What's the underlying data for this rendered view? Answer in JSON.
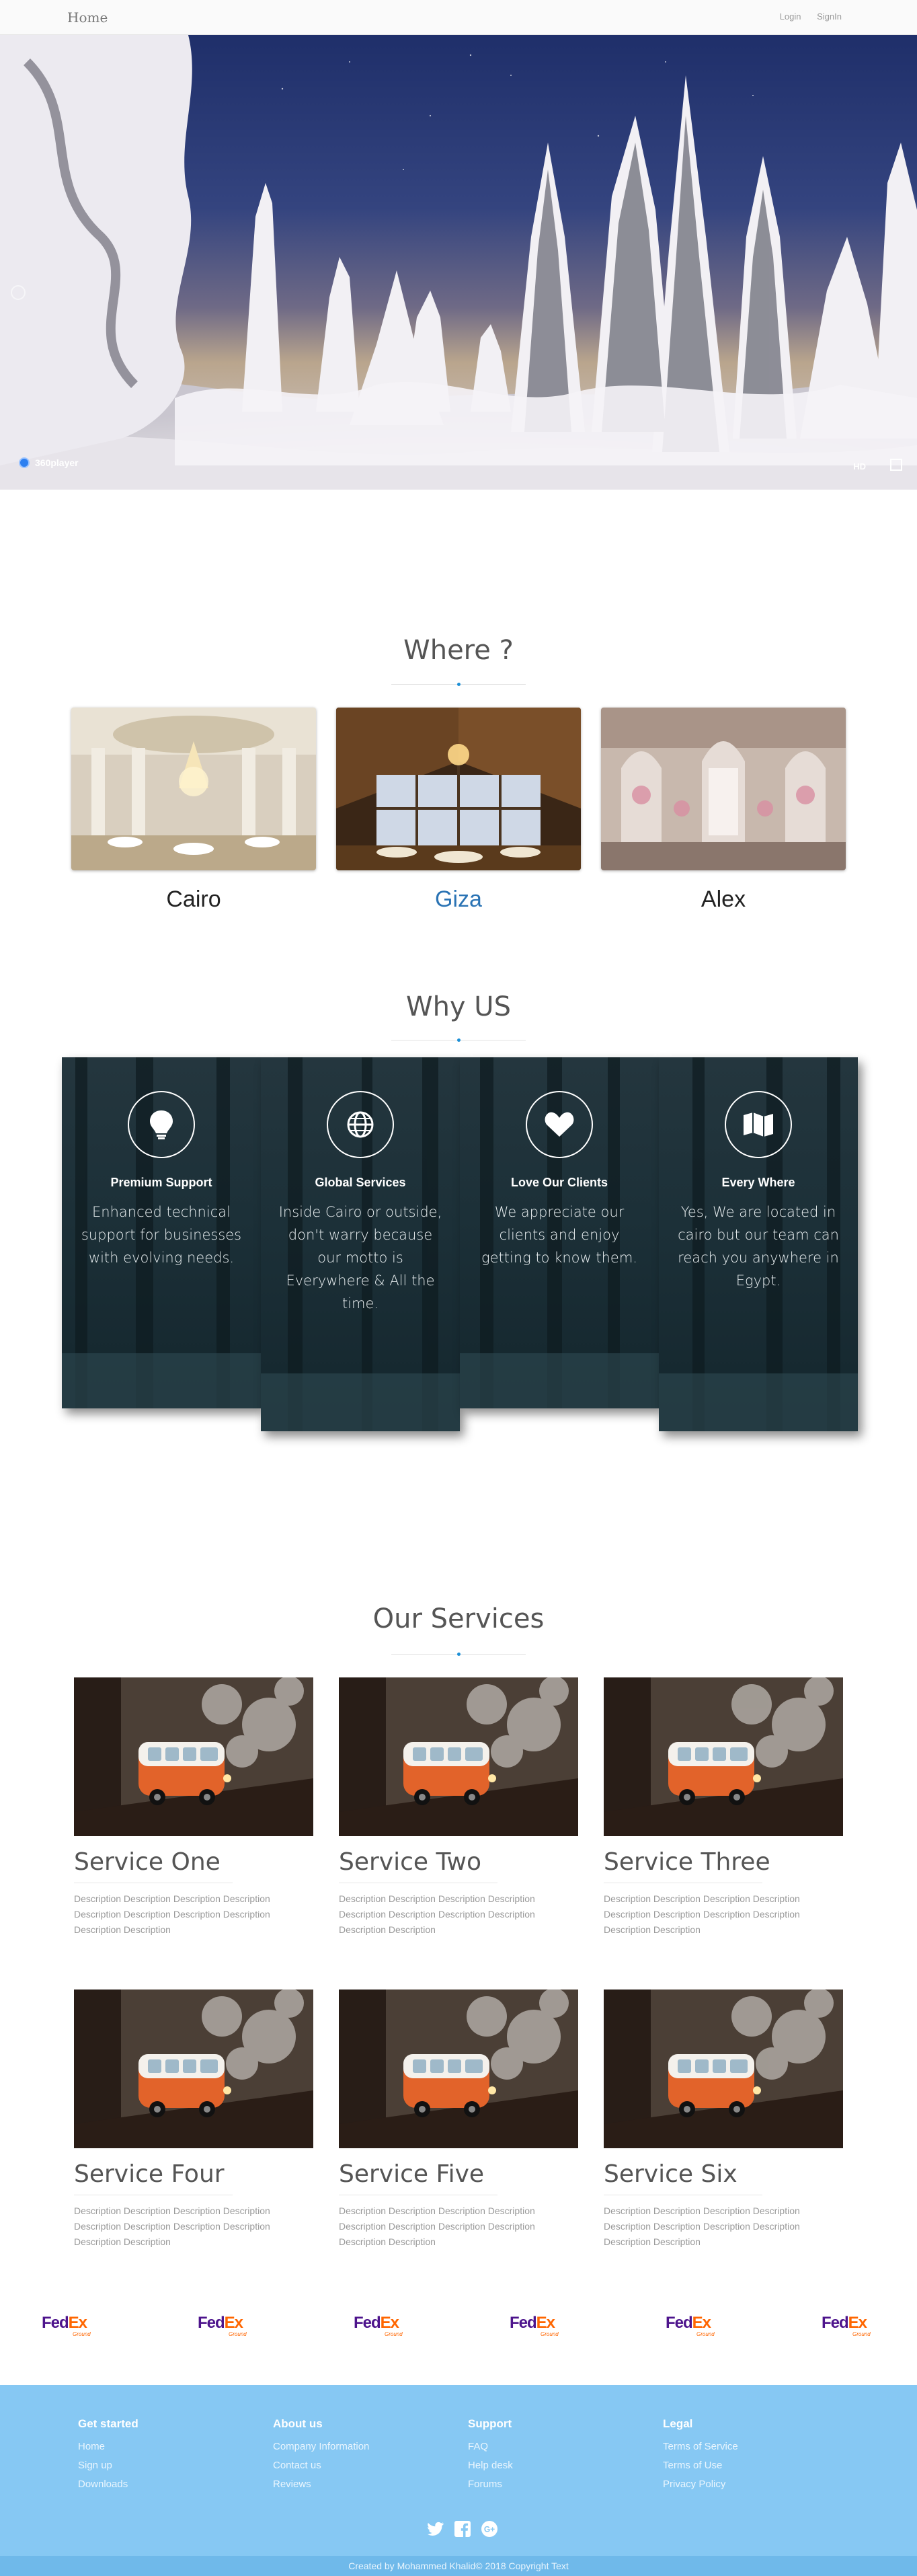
{
  "nav": {
    "brand": "Home",
    "login": "Login",
    "signin": "SignIn"
  },
  "hero": {
    "player_brand": "360player",
    "quality": "HD",
    "fullscreen_icon": "fullscreen-icon"
  },
  "where": {
    "title": "Where ?",
    "cards": [
      {
        "label": "Cairo",
        "active": false
      },
      {
        "label": "Giza",
        "active": true
      },
      {
        "label": "Alex",
        "active": false
      }
    ]
  },
  "why": {
    "title": "Why US",
    "cards": [
      {
        "icon": "lightbulb-icon",
        "heading": "Premium Support",
        "text": "Enhanced technical support for businesses with evolving needs."
      },
      {
        "icon": "globe-icon",
        "heading": "Global Services",
        "text": "Inside Cairo or outside, don't warry because our motto is Everywhere & All the time."
      },
      {
        "icon": "heart-icon",
        "heading": "Love Our Clients",
        "text": "We appreciate our clients and enjoy getting to know them."
      },
      {
        "icon": "map-icon",
        "heading": "Every Where",
        "text": "Yes, We are located in cairo but our team can reach you anywhere in Egypt."
      }
    ]
  },
  "services": {
    "title": "Our Services",
    "items": [
      {
        "name": "Service One",
        "desc": "Description Description Description Description Description Description Description Description Description Description"
      },
      {
        "name": "Service Two",
        "desc": "Description Description Description Description Description Description Description Description Description Description"
      },
      {
        "name": "Service Three",
        "desc": "Description Description Description Description Description Description Description Description Description Description"
      },
      {
        "name": "Service Four",
        "desc": "Description Description Description Description Description Description Description Description Description Description"
      },
      {
        "name": "Service Five",
        "desc": "Description Description Description Description Description Description Description Description Description Description"
      },
      {
        "name": "Service Six",
        "desc": "Description Description Description Description Description Description Description Description Description Description"
      }
    ]
  },
  "partners": {
    "logo_text_purple": "Fed",
    "logo_text_orange": "Ex",
    "logo_sub": "Ground",
    "count": 6
  },
  "footer": {
    "columns": [
      {
        "title": "Get started",
        "links": [
          "Home",
          "Sign up",
          "Downloads"
        ]
      },
      {
        "title": "About us",
        "links": [
          "Company Information",
          "Contact us",
          "Reviews"
        ]
      },
      {
        "title": "Support",
        "links": [
          "FAQ",
          "Help desk",
          "Forums"
        ]
      },
      {
        "title": "Legal",
        "links": [
          "Terms of Service",
          "Terms of Use",
          "Privacy Policy"
        ]
      }
    ],
    "social": [
      "twitter-icon",
      "facebook-icon",
      "google-plus-icon"
    ],
    "copyright": "Created by Mohammed Khalid© 2018 Copyright Text"
  },
  "colors": {
    "accent": "#1c8fd6",
    "active_location": "#2a73b4",
    "footer_bg": "#86c8f3",
    "copyright_bg": "#6fb9ea"
  }
}
